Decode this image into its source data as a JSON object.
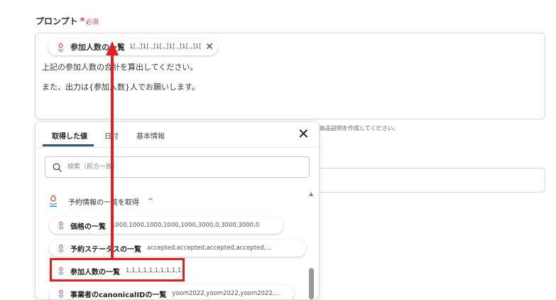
{
  "field": {
    "label": "プロンプト",
    "required_star": "*",
    "required_text": "必須"
  },
  "prompt": {
    "chip": {
      "name": "参加人数の一覧",
      "value": "1[.,]1[.,]1[.,]1[.,]1[.,]1[....",
      "close": "✕"
    },
    "lines": [
      "上記の参加人数の合計を算出してください。",
      "また、出力は{参加人数}人でお願いします。"
    ]
  },
  "helper_text": "商品説明を作成してください。",
  "popup": {
    "tabs": [
      "取得した値",
      "日付",
      "基本情報"
    ],
    "active_tab": 0,
    "close": "✕",
    "search_placeholder": "検索（前方一致）",
    "group": {
      "title": "予約情報の一覧を取得",
      "collapse_icon": "^"
    },
    "items": [
      {
        "name": "価格の一覧",
        "value": "1000,1000,1000,1000,1000,3000,0,3000,3000,0"
      },
      {
        "name": "予約ステータスの一覧",
        "value": "accepted,accepted,accepted,accepted,..."
      },
      {
        "name": "参加人数の一覧",
        "value": "1,1,1,1,1,1,1,1,1,1"
      },
      {
        "name": "事業者のcanonicalIDの一覧",
        "value": "yoom2022,yoom2022,yoom2022,..."
      }
    ]
  },
  "colors": {
    "accent_red": "#e0201e",
    "tab_underline": "#22566e",
    "required": "#e03a3a"
  },
  "icons": {
    "chip_logo": "yoom-logo-icon",
    "search": "search-icon",
    "collapse": "chevron-up-icon",
    "close": "close-icon"
  }
}
